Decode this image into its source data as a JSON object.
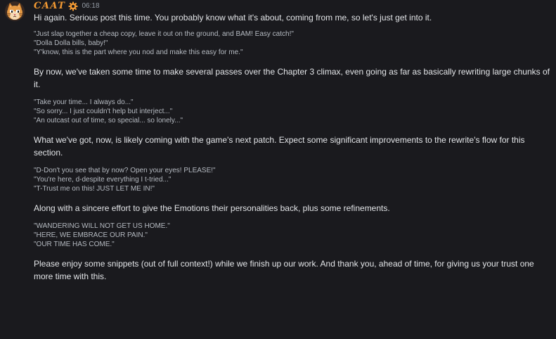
{
  "message": {
    "username": "CAAT",
    "timestamp": "06:18",
    "avatar_icon": "cat-face-avatar",
    "badge_icon": "gear-icon",
    "paragraphs": [
      "Hi again. Serious post this time. You probably know what it's about, coming from me, so let's just get into it.",
      "By now, we've taken some time to make several passes over the Chapter 3 climax, even going as far as basically rewriting large chunks of it.",
      "What we've got, now, is likely coming with the game's next patch. Expect some significant improvements to the rewrite's flow for this section.",
      "Along with a sincere effort to give the Emotions their personalities back, plus some refinements.",
      "Please enjoy some snippets (out of full context!) while we finish up our work. And thank you, ahead of time, for giving us your trust one more time with this."
    ],
    "quote_blocks": [
      [
        "\"Just slap together a cheap copy, leave it out on the ground, and BAM! Easy catch!\"",
        "\"Dolla Dolla bills, baby!\"",
        "\"Y'know, this is the part where you nod and make this easy for me.\""
      ],
      [
        "\"Take your time... I always do...\"",
        "\"So sorry... I just couldn't help but interject...\"",
        "\"An outcast out of time, so special... so lonely...\""
      ],
      [
        "\"D-Don't you see that by now? Open your eyes! PLEASE!\"",
        "\"You're here, d-despite everything I t-tried...\"",
        "\"T-Trust me on this! JUST LET ME IN!\""
      ],
      [
        "\"WANDERING WILL NOT GET US HOME.\"",
        "\"HERE, WE EMBRACE OUR PAIN.\"",
        "\"OUR TIME HAS COME.\""
      ]
    ]
  },
  "colors": {
    "background": "#1a1a1e",
    "username": "#f39a33",
    "text": "#e3e5e8",
    "quote_text": "#b5bac1",
    "timestamp": "#949ba4"
  }
}
